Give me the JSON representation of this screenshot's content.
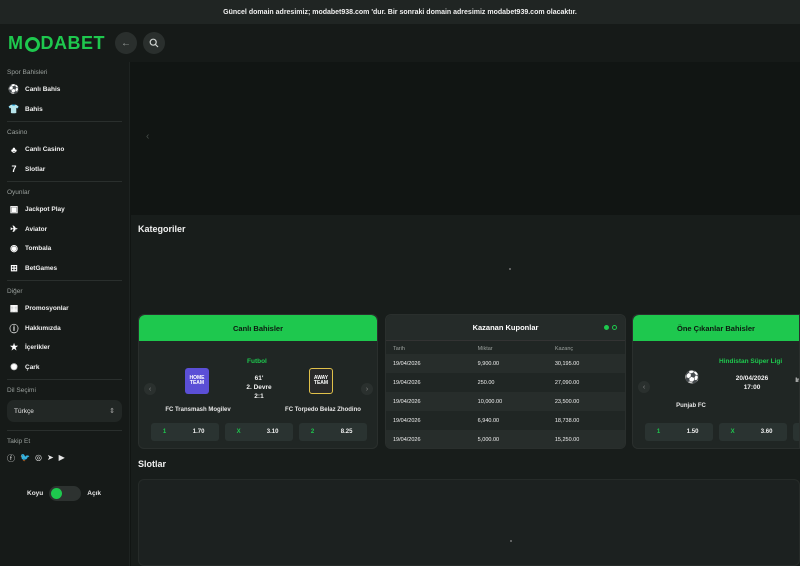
{
  "announcement": "Güncel domain adresimiz; modabet938.com 'dur. Bir sonraki domain adresimiz modabet939.com olacaktır.",
  "logo": {
    "m": "M",
    "rest": "DABET"
  },
  "sidebar": {
    "sections": [
      {
        "title": "Spor Bahisleri",
        "items": [
          {
            "label": "Canlı Bahis",
            "icon": "soccer-ball-icon"
          },
          {
            "label": "Bahis",
            "icon": "jersey-icon"
          }
        ]
      },
      {
        "title": "Casino",
        "items": [
          {
            "label": "Canlı Casino",
            "icon": "club-card-icon"
          },
          {
            "label": "Slotlar",
            "icon": "seven-icon"
          }
        ]
      },
      {
        "title": "Oyunlar",
        "items": [
          {
            "label": "Jackpot Play",
            "icon": "jackpot-icon"
          },
          {
            "label": "Aviator",
            "icon": "plane-icon"
          },
          {
            "label": "Tombala",
            "icon": "lottery-ball-icon"
          },
          {
            "label": "BetGames",
            "icon": "gamepad-icon"
          }
        ]
      },
      {
        "title": "Diğer",
        "items": [
          {
            "label": "Promosyonlar",
            "icon": "gift-icon"
          },
          {
            "label": "Hakkımızda",
            "icon": "info-icon"
          },
          {
            "label": "İçerikler",
            "icon": "star-icon"
          },
          {
            "label": "Çark",
            "icon": "wheel-icon"
          }
        ]
      }
    ],
    "language_title": "Dil Seçimi",
    "language_value": "Türkçe",
    "follow_title": "Takip Et",
    "theme_dark": "Koyu",
    "theme_light": "Açık"
  },
  "categories_title": "Kategoriler",
  "slots_title": "Slotlar",
  "live_card": {
    "title": "Canlı Bahisler",
    "sport": "Futbol",
    "home": "FC Transmash Mogilev",
    "away": "FC Torpedo Belaz Zhodino",
    "minute": "61'",
    "period": "2. Devre",
    "score": "2:1",
    "home_crest": "HOME TEAM",
    "away_crest": "AWAY TEAM",
    "odds": [
      {
        "label": "1",
        "value": "1.70"
      },
      {
        "label": "X",
        "value": "3.10"
      },
      {
        "label": "2",
        "value": "8.25"
      }
    ]
  },
  "coupons_card": {
    "title": "Kazanan Kuponlar",
    "headers": [
      "Tarih",
      "Miktar",
      "Kazanç"
    ],
    "rows": [
      [
        "19/04/2026",
        "9,900.00",
        "30,195.00"
      ],
      [
        "19/04/2026",
        "250.00",
        "27,090.00"
      ],
      [
        "19/04/2026",
        "10,000.00",
        "23,500.00"
      ],
      [
        "19/04/2026",
        "6,940.00",
        "18,738.00"
      ],
      [
        "19/04/2026",
        "5,000.00",
        "15,250.00"
      ]
    ]
  },
  "featured_card": {
    "title": "Öne Çıkanlar Bahisler",
    "league": "Hindistan Süper Ligi",
    "home": "Punjab FC",
    "date": "20/04/2026",
    "time": "17:00",
    "away_partial": "In",
    "odds": [
      {
        "label": "1",
        "value": "1.50"
      },
      {
        "label": "X",
        "value": "3.60"
      }
    ]
  },
  "colors": {
    "accent": "#1ec84e",
    "bg": "#111513",
    "panel": "#161a18"
  }
}
